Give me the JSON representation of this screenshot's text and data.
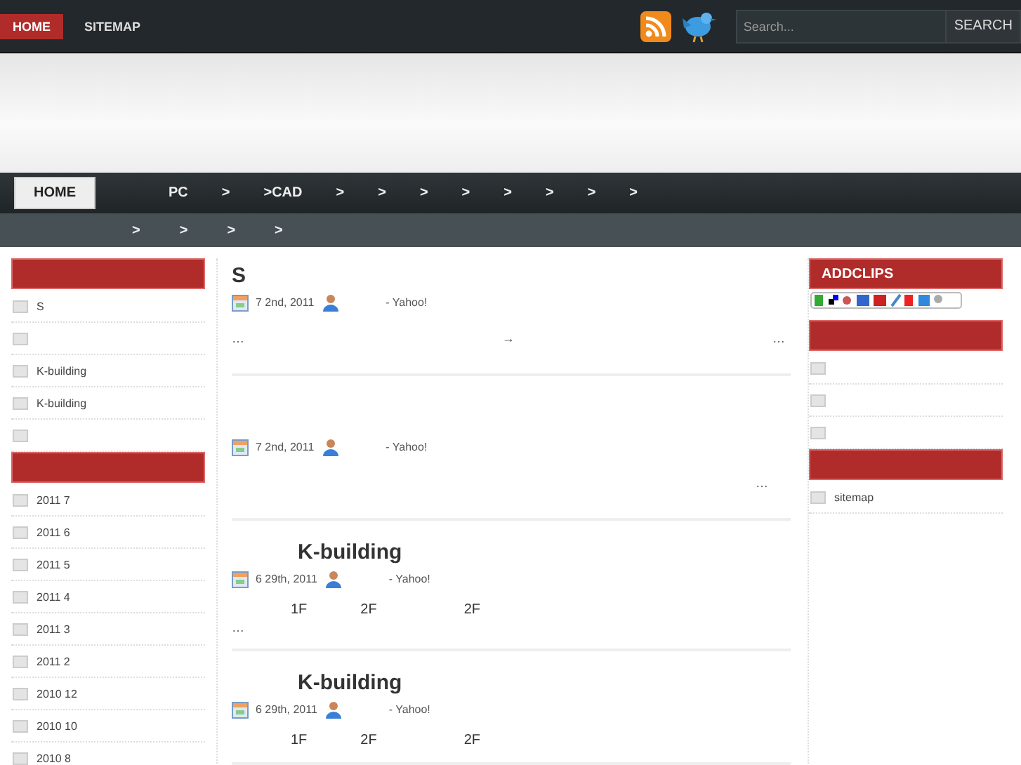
{
  "top_menu": [
    {
      "label": "HOME",
      "selected": true
    },
    {
      "label": "SITEMAP",
      "selected": false
    }
  ],
  "search": {
    "placeholder": "Search...",
    "button": "SEARCH"
  },
  "nav": {
    "home": "HOME",
    "row_1": [
      "PC",
      ">",
      ">CAD",
      ">",
      ">",
      ">",
      ">",
      ">",
      ">",
      ">",
      ">"
    ],
    "row_2": [
      ">",
      ">",
      ">",
      ">"
    ]
  },
  "left_sidebar": [
    {
      "items": [
        {
          "kind": "link",
          "label": "S"
        },
        {
          "kind": "blank"
        },
        {
          "kind": "link",
          "label": "K-building"
        },
        {
          "kind": "link",
          "label": "K-building"
        },
        {
          "kind": "blank"
        }
      ]
    },
    {
      "items": [
        {
          "kind": "link",
          "label": "2011 7"
        },
        {
          "kind": "link",
          "label": "2011 6"
        },
        {
          "kind": "link",
          "label": "2011 5"
        },
        {
          "kind": "link",
          "label": "2011 4"
        },
        {
          "kind": "link",
          "label": "2011 3"
        },
        {
          "kind": "link",
          "label": "2011 2"
        },
        {
          "kind": "link",
          "label": "2010 12"
        },
        {
          "kind": "link",
          "label": "2010 10"
        },
        {
          "kind": "link",
          "label": "2010 8"
        }
      ]
    }
  ],
  "posts": [
    {
      "title": "S",
      "date": "7  2nd, 2011",
      "category": "- Yahoo!",
      "excerpt": [
        "…",
        "→",
        "…"
      ]
    },
    {
      "date": "7  2nd, 2011",
      "category": "- Yahoo!",
      "excerpt_end": "…"
    },
    {
      "title": "K-building",
      "date": "6  29th, 2011",
      "category": "- Yahoo!",
      "floors": [
        "1F",
        "2F",
        "2F"
      ],
      "more": "…"
    },
    {
      "title": "K-building",
      "date": "6  29th, 2011",
      "category": "- Yahoo!",
      "floors": [
        "1F",
        "2F",
        "2F"
      ]
    }
  ],
  "right_sidebar": [
    {
      "title": "ADDCLIPS",
      "kind": "clips"
    },
    {
      "kind": "list",
      "items": [
        {
          "kind": "blank"
        },
        {
          "kind": "blank"
        },
        {
          "kind": "blank"
        }
      ]
    },
    {
      "kind": "list",
      "items": [
        {
          "kind": "link",
          "label": "sitemap"
        }
      ]
    }
  ]
}
